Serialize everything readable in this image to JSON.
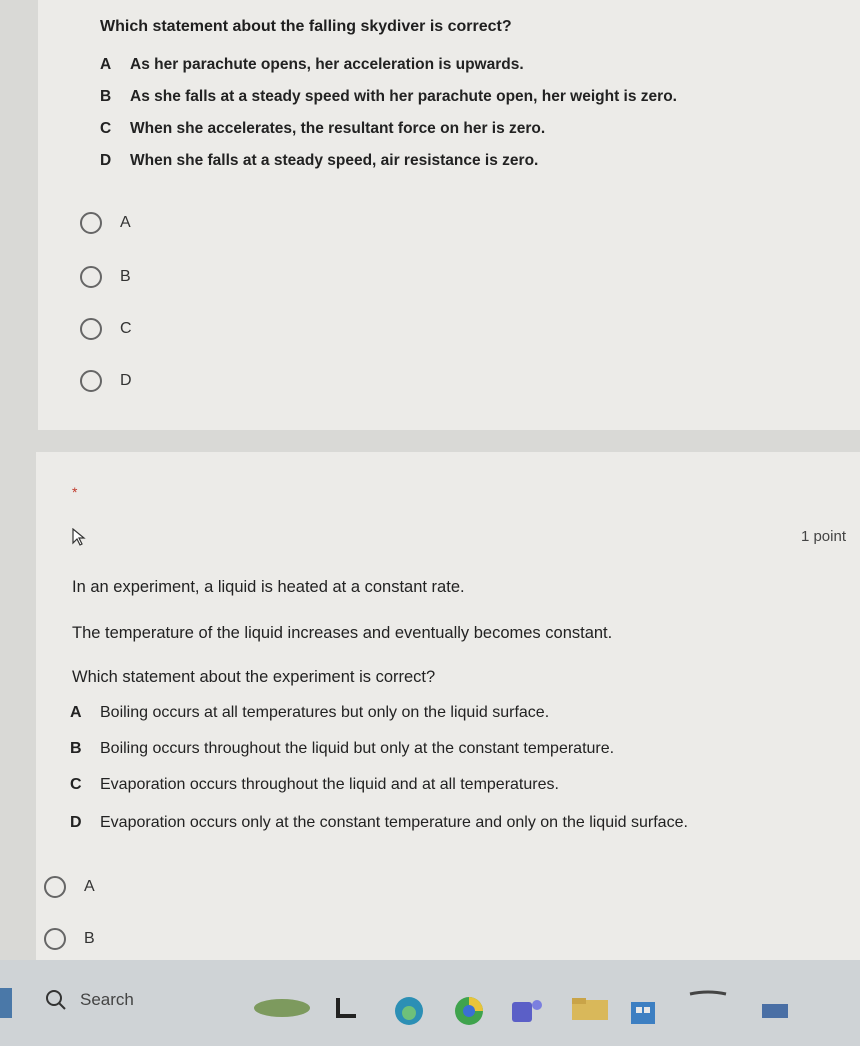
{
  "question1": {
    "title": "Which statement about the falling skydiver is correct?",
    "options": [
      {
        "letter": "A",
        "text": "As her parachute opens, her acceleration is upwards."
      },
      {
        "letter": "B",
        "text": "As she falls at a steady speed with her parachute open, her weight is zero."
      },
      {
        "letter": "C",
        "text": "When she accelerates, the resultant force on her is zero."
      },
      {
        "letter": "D",
        "text": "When she falls at a steady speed, air resistance is zero."
      }
    ],
    "choices": [
      "A",
      "B",
      "C",
      "D"
    ]
  },
  "question2": {
    "required_marker": "*",
    "points": "1 point",
    "intro1": "In an experiment, a liquid is heated at a constant rate.",
    "intro2": "The temperature of the liquid increases and eventually becomes constant.",
    "prompt": "Which statement about the experiment is correct?",
    "options": [
      {
        "letter": "A",
        "text": "Boiling occurs at all temperatures but only on the liquid surface."
      },
      {
        "letter": "B",
        "text": "Boiling occurs throughout the liquid but only at the constant temperature."
      },
      {
        "letter": "C",
        "text": "Evaporation occurs throughout the liquid and at all temperatures."
      },
      {
        "letter": "D",
        "text": "Evaporation occurs only at the constant temperature and only on the liquid surface."
      }
    ],
    "choices": [
      "A",
      "B"
    ]
  },
  "taskbar": {
    "search_label": "Search",
    "icons": [
      "search-icon",
      "weather-icon",
      "file-explorer-icon",
      "edge-icon",
      "chrome-icon",
      "teams-icon",
      "folder-icon",
      "store-icon",
      "app-icon"
    ]
  },
  "colors": {
    "card": "#ecebe8",
    "background": "#d9d9d6",
    "taskbar": "#cfd3d6",
    "required": "#c0392b"
  }
}
